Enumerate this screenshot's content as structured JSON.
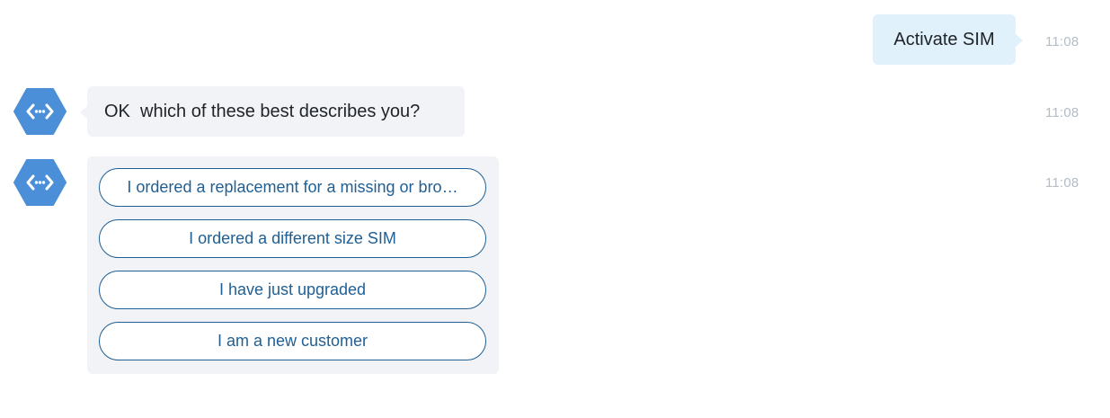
{
  "messages": {
    "user_message": {
      "text": "Activate SIM",
      "time": "11:08"
    },
    "bot_message": {
      "text": "OK  which of these best describes you?",
      "time": "11:08",
      "avatar_icon": "code-brackets-hexagon-icon"
    },
    "bot_options": {
      "time": "11:08",
      "avatar_icon": "code-brackets-hexagon-icon",
      "options": [
        "I ordered a replacement for a missing or bro…",
        "I ordered a different size SIM",
        "I have just upgraded",
        "I am a new customer"
      ]
    }
  },
  "colors": {
    "user_bubble": "#e1f1fb",
    "bot_bubble": "#f1f3f7",
    "option_accent": "#1f5f94",
    "avatar": "#4a8fd8",
    "timestamp": "#b4bcc6"
  }
}
